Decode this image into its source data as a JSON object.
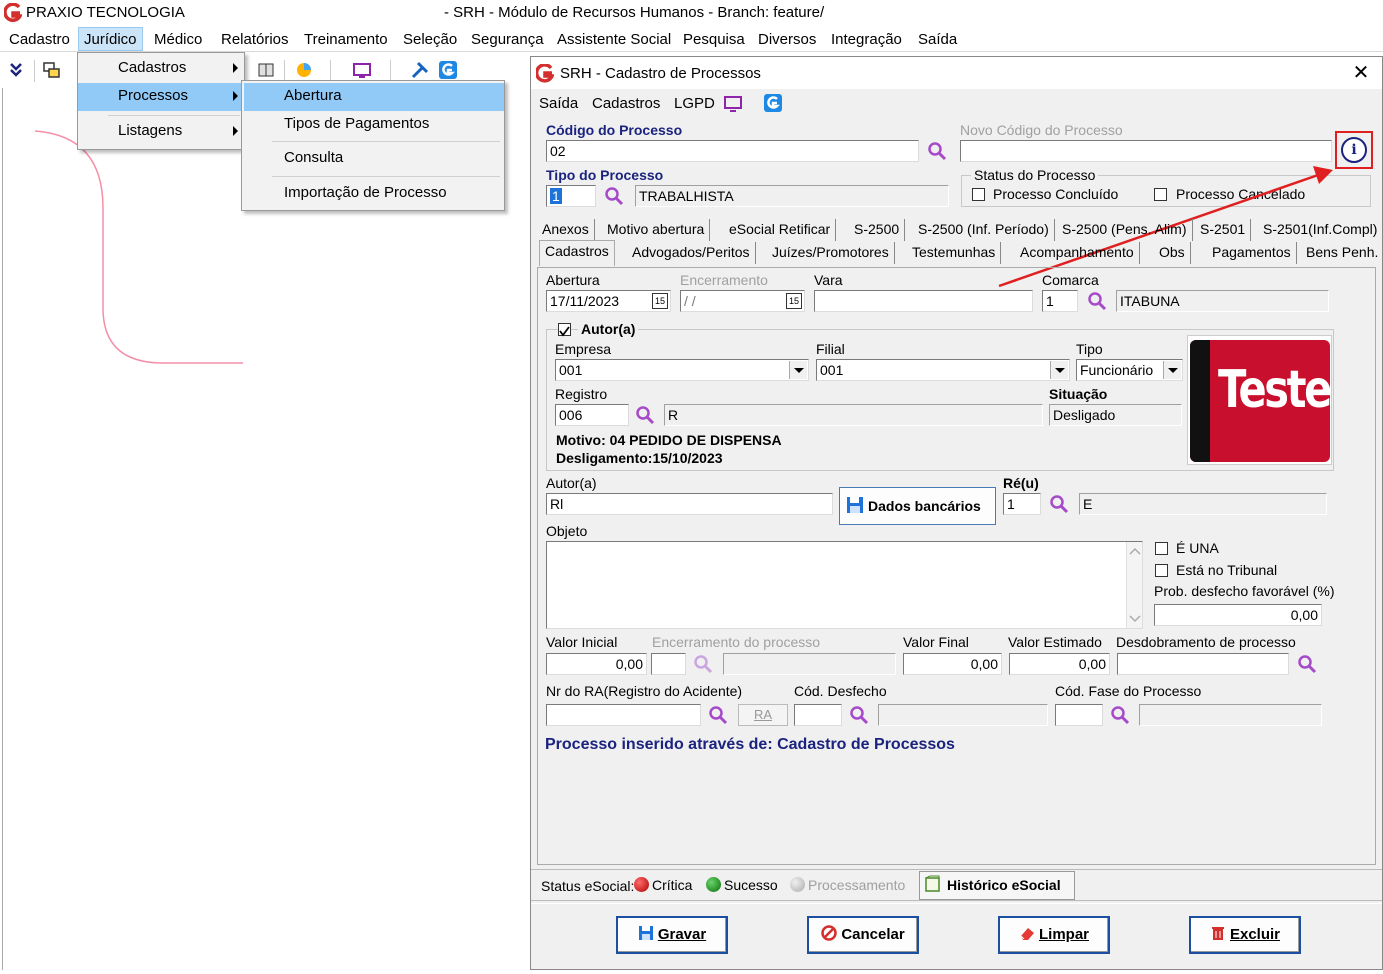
{
  "app": {
    "name": "PRAXIO TECNOLOGIA",
    "window_title": "- SRH - Módulo de Recursos Humanos - Branch: feature/"
  },
  "menubar": [
    "Cadastro",
    "Jurídico",
    "Médico",
    "Relatórios",
    "Treinamento",
    "Seleção",
    "Segurança",
    "Assistente Social",
    "Pesquisa",
    "Diversos",
    "Integração",
    "Saída"
  ],
  "juridico_menu": {
    "items": [
      "Cadastros",
      "Processos",
      "Listagens"
    ],
    "selected": "Processos"
  },
  "processos_submenu": {
    "items": [
      "Abertura",
      "Tipos de Pagamentos",
      "Consulta",
      "Importação de Processo"
    ],
    "selected": "Abertura"
  },
  "dialog": {
    "title": "SRH - Cadastro de Processos",
    "close": "✕",
    "menu": [
      "Saída",
      "Cadastros",
      "LGPD"
    ],
    "codigo_processo_label": "Código do Processo",
    "codigo_processo_value": "02",
    "novo_codigo_label": "Novo Código do Processo",
    "novo_codigo_value": "",
    "info_icon": "i",
    "tipo_processo_label": "Tipo do Processo",
    "tipo_processo_code": "1",
    "tipo_processo_value": "TRABALHISTA",
    "status_processo_label": "Status do Processo",
    "processo_concluido": "Processo Concluído",
    "processo_cancelado": "Processo Cancelado",
    "tabs_row1": [
      "Anexos",
      "Motivo abertura",
      "eSocial Retificar",
      "S-2500",
      "S-2500 (Inf. Período)",
      "S-2500 (Pens. Alim)",
      "S-2501",
      "S-2501(Inf.Compl)"
    ],
    "tabs_row2": [
      "Cadastros",
      "Advogados/Peritos",
      "Juízes/Promotores",
      "Testemunhas",
      "Acompanhamento",
      "Obs",
      "Pagamentos",
      "Bens Penh."
    ],
    "active_tab": "Cadastros",
    "abertura_label": "Abertura",
    "abertura_value": "17/11/2023",
    "encerramento_label": "Encerramento",
    "encerramento_value": "/ /",
    "calendar_glyph": "15",
    "vara_label": "Vara",
    "vara_value": "",
    "comarca_label": "Comarca",
    "comarca_code": "1",
    "comarca_value": "ITABUNA",
    "autor_group_label": "Autor(a)",
    "empresa_label": "Empresa",
    "empresa_value": "001",
    "filial_label": "Filial",
    "filial_value": "001",
    "tipo_label": "Tipo",
    "tipo_value": "Funcionário",
    "registro_label": "Registro",
    "registro_value": "006",
    "registro_name": "R",
    "situacao_label": "Situação",
    "situacao_value": "Desligado",
    "motivo_text": "Motivo: 04 PEDIDO DE DISPENSA",
    "desligamento_text": "Desligamento:15/10/2023",
    "photo_text": "Teste",
    "autor_label": "Autor(a)",
    "autor_value": "Rl",
    "dados_bancarios": "Dados bancários",
    "reu_label": "Ré(u)",
    "reu_code": "1",
    "reu_value": "E",
    "objeto_label": "Objeto",
    "e_una": "É UNA",
    "esta_tribunal": "Está no Tribunal",
    "prob_desfecho_label": "Prob. desfecho favorável (%)",
    "prob_desfecho_value": "0,00",
    "valor_inicial_label": "Valor Inicial",
    "valor_inicial_value": "0,00",
    "encerramento_processo_label": "Encerramento do processo",
    "valor_final_label": "Valor Final",
    "valor_final_value": "0,00",
    "valor_estimado_label": "Valor Estimado",
    "valor_estimado_value": "0,00",
    "desdobramento_label": "Desdobramento de processo",
    "nr_ra_label": "Nr do RA(Registro do Acidente)",
    "ra_button": "RA",
    "cod_desfecho_label": "Cód. Desfecho",
    "cod_fase_label": "Cód. Fase do Processo",
    "inserted_via": "Processo inserido através de: Cadastro de Processos",
    "status_esocial_label": "Status eSocial:",
    "status_critica": "Crítica",
    "status_sucesso": "Sucesso",
    "status_processamento": "Processamento",
    "historico_esocial": "Histórico eSocial",
    "buttons": {
      "gravar": "Gravar",
      "cancelar": "Cancelar",
      "limpar": "Limpar",
      "excluir": "Excluir"
    }
  },
  "colors": {
    "accent_blue": "#1a237e",
    "menu_highlight": "#91c9f7",
    "annotation_red": "#e02020",
    "photo_red": "#c8102e"
  }
}
